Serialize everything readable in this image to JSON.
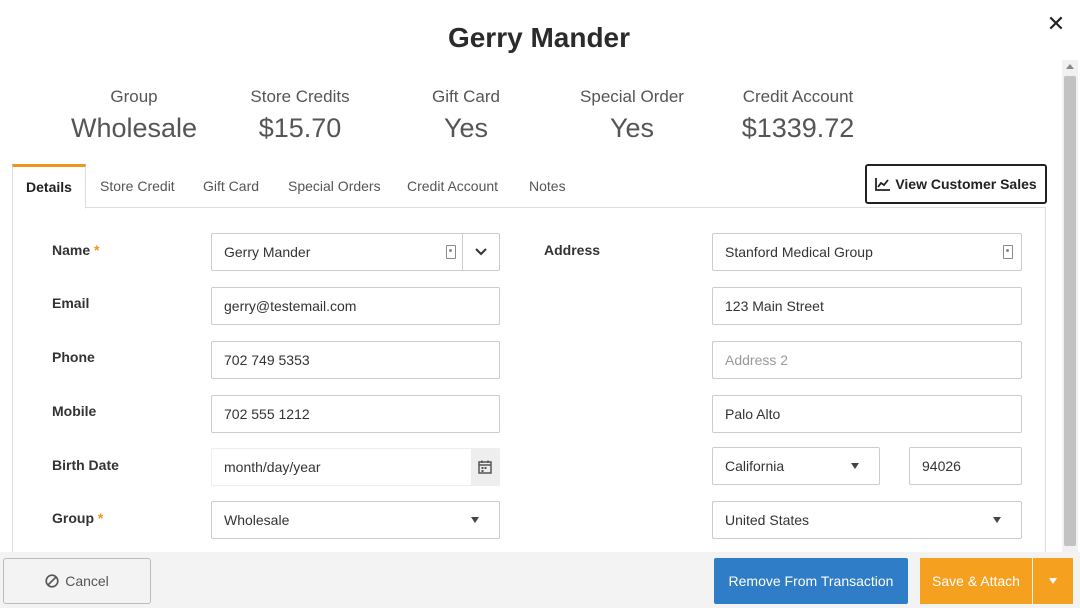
{
  "customer": {
    "name": "Gerry Mander"
  },
  "close_label": "✕",
  "stats": [
    {
      "label": "Group",
      "value": "Wholesale"
    },
    {
      "label": "Store Credits",
      "value": "$15.70"
    },
    {
      "label": "Gift Card",
      "value": "Yes"
    },
    {
      "label": "Special Order",
      "value": "Yes"
    },
    {
      "label": "Credit Account",
      "value": "$1339.72"
    }
  ],
  "tabs": [
    {
      "label": "Details",
      "active": true
    },
    {
      "label": "Store Credit"
    },
    {
      "label": "Gift Card"
    },
    {
      "label": "Special Orders"
    },
    {
      "label": "Credit Account"
    },
    {
      "label": "Notes"
    }
  ],
  "view_sales_label": "View Customer Sales",
  "form": {
    "name_label": "Name",
    "required_mark": "*",
    "name_value": "Gerry Mander",
    "email_label": "Email",
    "email_value": "gerry@testemail.com",
    "phone_label": "Phone",
    "phone_value": "702 749 5353",
    "mobile_label": "Mobile",
    "mobile_value": "702 555 1212",
    "birth_label": "Birth Date",
    "birth_placeholder": "month/day/year",
    "group_label": "Group",
    "group_value": "Wholesale",
    "address_label": "Address",
    "address_company": "Stanford Medical Group",
    "address_line1": "123 Main Street",
    "address2_placeholder": "Address 2",
    "city": "Palo Alto",
    "state": "California",
    "zip": "94026",
    "country": "United States"
  },
  "footer": {
    "cancel_label": "Cancel",
    "remove_label": "Remove From Transaction",
    "save_label": "Save & Attach"
  },
  "colors": {
    "accent": "#f0941f",
    "primary_blue": "#2e7dc6",
    "save_orange": "#f5a01f"
  }
}
